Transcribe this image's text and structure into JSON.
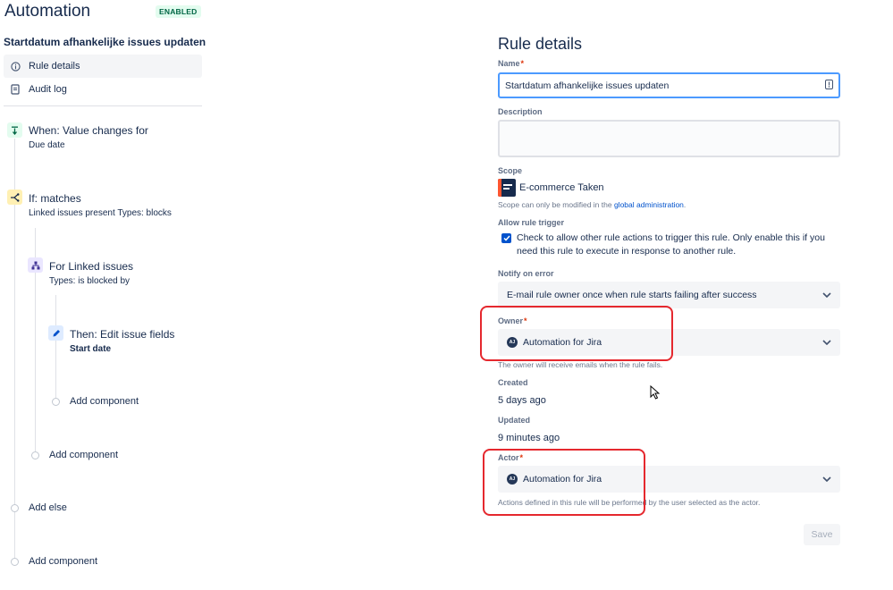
{
  "header": {
    "app_title": "Automation",
    "status_badge": "ENABLED",
    "rule_name": "Startdatum afhankelijke issues updaten"
  },
  "nav": {
    "rule_details": "Rule details",
    "audit_log": "Audit log"
  },
  "flow": {
    "trigger": {
      "title": "When: Value changes for",
      "subtitle": "Due date"
    },
    "condition": {
      "title": "If: matches",
      "subtitle": "Linked issues present Types: blocks"
    },
    "branch": {
      "title": "For Linked issues",
      "subtitle": "Types: is blocked by"
    },
    "action": {
      "title": "Then: Edit issue fields",
      "subtitle": "Start date"
    },
    "add_component_inner": "Add component",
    "add_component_branch": "Add component",
    "add_else": "Add else",
    "add_component_outer": "Add component"
  },
  "details": {
    "title": "Rule details",
    "name_label": "Name",
    "name_value": "Startdatum afhankelijke issues updaten",
    "description_label": "Description",
    "scope_label": "Scope",
    "scope_value": "E-commerce Taken",
    "scope_helper_prefix": "Scope can only be modified in the ",
    "scope_helper_link": "global administration",
    "scope_helper_suffix": ".",
    "allow_trigger_label": "Allow rule trigger",
    "allow_trigger_text": "Check to allow other rule actions to trigger this rule. Only enable this if you need this rule to execute in response to another rule.",
    "notify_label": "Notify on error",
    "notify_value": "E-mail rule owner once when rule starts failing after success",
    "owner_label": "Owner",
    "owner_value": "Automation for Jira",
    "owner_avatar": "AJ",
    "owner_helper": "The owner will receive emails when the rule fails.",
    "created_label": "Created",
    "created_value": "5 days ago",
    "updated_label": "Updated",
    "updated_value": "9 minutes ago",
    "actor_label": "Actor",
    "actor_value": "Automation for Jira",
    "actor_avatar": "AJ",
    "actor_helper": "Actions defined in this rule will be performed by the user selected as the actor.",
    "required_mark": "*",
    "save_label": "Save"
  },
  "colors": {
    "accent": "#0052cc",
    "focus_border": "#4c9aff",
    "highlight": "#e5282e",
    "badge_bg": "#e3fcef",
    "badge_text": "#006644"
  },
  "icons": {
    "rule_details": "info-icon",
    "audit_log": "document-icon",
    "trigger": "trigger-icon",
    "condition": "condition-branch-icon",
    "branch": "hierarchy-icon",
    "action": "pencil-icon",
    "name_field": "password-manager-icon",
    "select": "chevron-down-icon"
  }
}
